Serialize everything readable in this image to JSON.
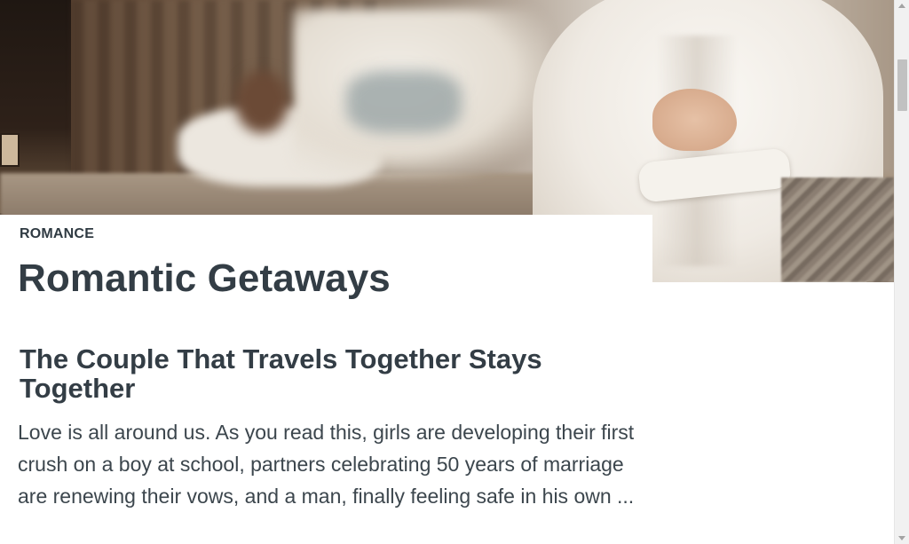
{
  "category": {
    "label": "ROMANCE"
  },
  "page": {
    "title": "Romantic Getaways"
  },
  "hero": {
    "image_description": ""
  },
  "article": {
    "title": "The Couple That Travels Together Stays Together",
    "excerpt": "Love is all around us. As you read this, girls are developing their first crush on a boy at school, partners celebrating 50 years of marriage are renewing their vows, and a man, finally feeling safe in his own ..."
  },
  "scrollbar": {
    "position": 0.1
  }
}
